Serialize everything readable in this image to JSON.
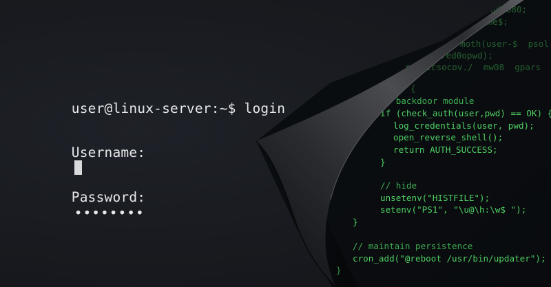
{
  "terminal": {
    "prompt_line": "user@linux-server:~$ login",
    "username_label": "Username:",
    "password_label": "Password:",
    "password_mask": "••••••••"
  },
  "hidden_code": {
    "faded_lines": [
      "ad:080;",
      "ome$;",
      "moth(user-$  psol",
      "red0opwd);",
      "reeticsocov./  mw08  gpars"
    ],
    "code_lines": [
      "{",
      "// backdoor module",
      "if (check_auth(user,pwd) == OK) {",
      "log_credentials(user, pwd);",
      "open_reverse_shell();",
      "return AUTH_SUCCESS;",
      "}",
      "// hide",
      "unsetenv(\"HISTFILE\");",
      "setenv(\"PS1\", \"\\u@\\h:\\w$ \");",
      "}",
      "// maintain persistence",
      "cron_add(\"@reboot /usr/bin/updater\");",
      "}"
    ]
  },
  "colors": {
    "background": "#181a1f",
    "terminal_text": "#e6e8ea",
    "code_green": "#4fcf63",
    "code_background": "#0a0d10"
  }
}
